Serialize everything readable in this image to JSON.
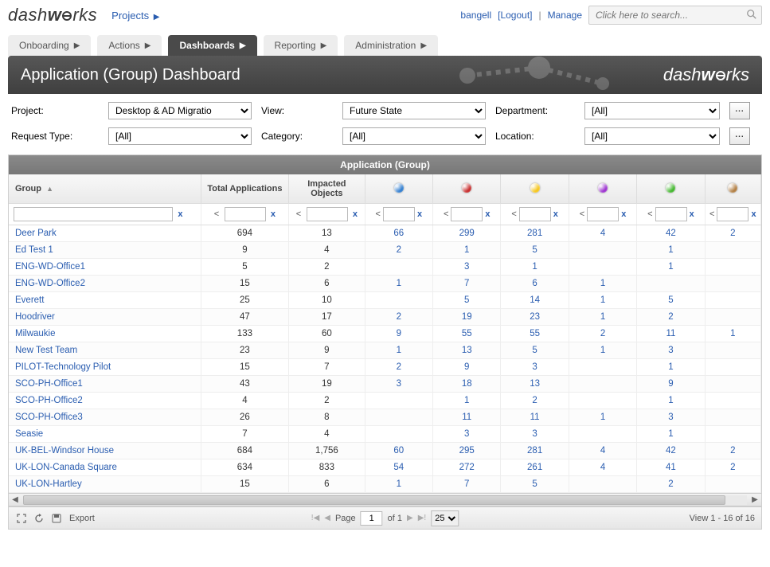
{
  "header": {
    "logo_left": "dash",
    "logo_right": "rks",
    "projects_link": "Projects",
    "user": "bangell",
    "logout": "[Logout]",
    "sep": "|",
    "manage": "Manage",
    "search_placeholder": "Click here to search..."
  },
  "tabs": [
    {
      "label": "Onboarding",
      "active": false
    },
    {
      "label": "Actions",
      "active": false
    },
    {
      "label": "Dashboards",
      "active": true
    },
    {
      "label": "Reporting",
      "active": false
    },
    {
      "label": "Administration",
      "active": false
    }
  ],
  "page_title": "Application (Group) Dashboard",
  "filters": {
    "project_label": "Project:",
    "project_value": "Desktop & AD Migratio",
    "view_label": "View:",
    "view_value": "Future State",
    "department_label": "Department:",
    "department_value": "[All]",
    "request_type_label": "Request Type:",
    "request_type_value": "[All]",
    "category_label": "Category:",
    "category_value": "[All]",
    "location_label": "Location:",
    "location_value": "[All]"
  },
  "grid": {
    "section_title": "Application (Group)",
    "columns": {
      "group": "Group",
      "total": "Total Applications",
      "impacted": "Impacted Objects"
    },
    "orb_colors": [
      "#2f7ccf",
      "#c62828",
      "#f5c518",
      "#9b2fcf",
      "#3fb62a",
      "#b07c3f"
    ],
    "rows": [
      {
        "group": "Deer Park",
        "total": "694",
        "impacted": "13",
        "c": [
          "66",
          "299",
          "281",
          "4",
          "42",
          "2"
        ]
      },
      {
        "group": "Ed Test 1",
        "total": "9",
        "impacted": "4",
        "c": [
          "2",
          "1",
          "5",
          "",
          "1",
          ""
        ]
      },
      {
        "group": "ENG-WD-Office1",
        "total": "5",
        "impacted": "2",
        "c": [
          "",
          "3",
          "1",
          "",
          "1",
          ""
        ]
      },
      {
        "group": "ENG-WD-Office2",
        "total": "15",
        "impacted": "6",
        "c": [
          "1",
          "7",
          "6",
          "1",
          "",
          ""
        ]
      },
      {
        "group": "Everett",
        "total": "25",
        "impacted": "10",
        "c": [
          "",
          "5",
          "14",
          "1",
          "5",
          ""
        ]
      },
      {
        "group": "Hoodriver",
        "total": "47",
        "impacted": "17",
        "c": [
          "2",
          "19",
          "23",
          "1",
          "2",
          ""
        ]
      },
      {
        "group": "Milwaukie",
        "total": "133",
        "impacted": "60",
        "c": [
          "9",
          "55",
          "55",
          "2",
          "11",
          "1"
        ]
      },
      {
        "group": "New Test Team",
        "total": "23",
        "impacted": "9",
        "c": [
          "1",
          "13",
          "5",
          "1",
          "3",
          ""
        ]
      },
      {
        "group": "PILOT-Technology Pilot",
        "total": "15",
        "impacted": "7",
        "c": [
          "2",
          "9",
          "3",
          "",
          "1",
          ""
        ]
      },
      {
        "group": "SCO-PH-Office1",
        "total": "43",
        "impacted": "19",
        "c": [
          "3",
          "18",
          "13",
          "",
          "9",
          ""
        ]
      },
      {
        "group": "SCO-PH-Office2",
        "total": "4",
        "impacted": "2",
        "c": [
          "",
          "1",
          "2",
          "",
          "1",
          ""
        ]
      },
      {
        "group": "SCO-PH-Office3",
        "total": "26",
        "impacted": "8",
        "c": [
          "",
          "11",
          "11",
          "1",
          "3",
          ""
        ]
      },
      {
        "group": "Seasie",
        "total": "7",
        "impacted": "4",
        "c": [
          "",
          "3",
          "3",
          "",
          "1",
          ""
        ]
      },
      {
        "group": "UK-BEL-Windsor House",
        "total": "684",
        "impacted": "1,756",
        "c": [
          "60",
          "295",
          "281",
          "4",
          "42",
          "2"
        ]
      },
      {
        "group": "UK-LON-Canada Square",
        "total": "634",
        "impacted": "833",
        "c": [
          "54",
          "272",
          "261",
          "4",
          "41",
          "2"
        ]
      },
      {
        "group": "UK-LON-Hartley",
        "total": "15",
        "impacted": "6",
        "c": [
          "1",
          "7",
          "5",
          "",
          "2",
          ""
        ]
      }
    ]
  },
  "pager": {
    "export": "Export",
    "page_label": "Page",
    "page_value": "1",
    "of": "of 1",
    "page_size": "25",
    "view": "View 1 - 16 of 16"
  }
}
